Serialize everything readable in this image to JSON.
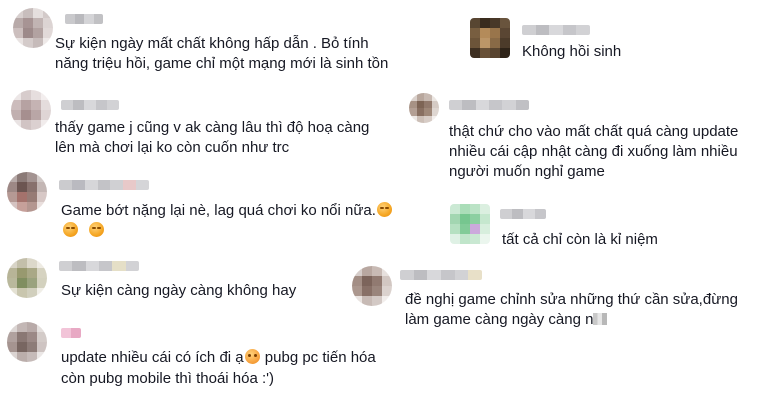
{
  "comments": [
    {
      "id": "c1",
      "text_lines": [
        "Sự kiện ngày mất chất không hấp dẫn . Bỏ tính",
        "năng triệu hồi, game chỉ một mạng mới là sinh tồn"
      ]
    },
    {
      "id": "c2",
      "text_lines": [
        "thấy game j cũng v ak càng lâu thì độ hoạ càng",
        "lên mà chơi lại ko còn cuốn như trc"
      ]
    },
    {
      "id": "c3",
      "text_lines": [
        "Game bớt nặng lại nè, lag quá chơi ko nổi nữa.",
        ""
      ]
    },
    {
      "id": "c4",
      "text_lines": [
        "Sự kiện càng ngày càng không hay"
      ]
    },
    {
      "id": "c5",
      "text_lines": [
        "update nhiều cái có ích đi ạ",
        " pubg pc tiến hóa",
        "còn pubg mobile thì thoái hóa :')"
      ]
    },
    {
      "id": "c6",
      "text_lines": [
        "Không hồi sinh"
      ]
    },
    {
      "id": "c7",
      "text_lines": [
        "thật chứ cho vào mất chất quá càng update",
        "nhiều cái cập nhật càng đi xuống làm nhiều",
        "người muốn nghỉ game"
      ]
    },
    {
      "id": "c8",
      "text_lines": [
        "tất cả chỉ còn là kỉ niệm"
      ]
    },
    {
      "id": "c9",
      "text_lines": [
        "đề nghị game chỉnh sửa những thứ cần sửa,đừng",
        "làm game càng ngày càng n"
      ]
    }
  ],
  "icons": {
    "emoji_pensive": "pensive-face-emoji-icon",
    "emoji_crying": "crying-face-emoji-icon"
  }
}
